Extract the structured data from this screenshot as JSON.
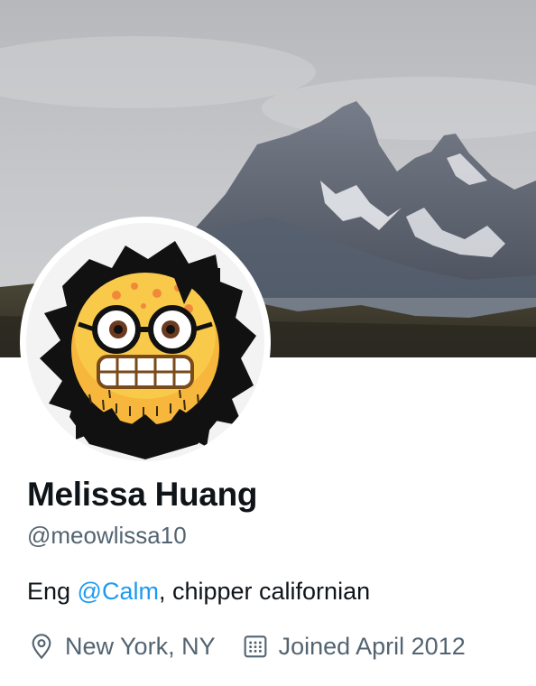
{
  "profile": {
    "display_name": "Melissa Huang",
    "handle": "@meowlissa10",
    "bio": {
      "prefix": "Eng ",
      "mention": "@Calm",
      "suffix": ", chipper californian"
    },
    "location": "New York, NY",
    "joined": "Joined April 2012"
  },
  "icons": {
    "location": "location-pin-icon",
    "joined": "calendar-icon"
  },
  "colors": {
    "link": "#1d9bf0",
    "secondary_text": "#536471",
    "primary_text": "#0f1419"
  }
}
